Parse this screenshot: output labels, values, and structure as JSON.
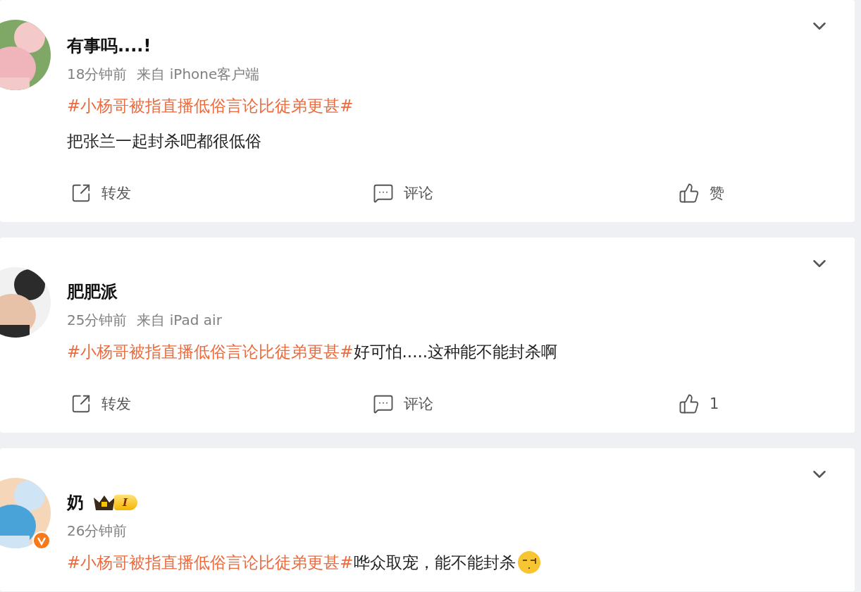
{
  "posts": [
    {
      "author": "有事吗....!",
      "verified": false,
      "time": "18分钟前",
      "source": "来自 iPhone客户端",
      "paragraphs": [
        [
          {
            "kind": "hashtag",
            "text": "#小杨哥被指直播低俗言论比徒弟更甚#"
          }
        ],
        [
          {
            "kind": "text",
            "text": "把张兰一起封杀吧都很低俗"
          }
        ]
      ],
      "actions": {
        "repost": "转发",
        "comment": "评论",
        "like": "赞"
      }
    },
    {
      "author": "肥肥派",
      "verified": false,
      "time": "25分钟前",
      "source": "来自 iPad air",
      "paragraphs": [
        [
          {
            "kind": "hashtag",
            "text": "#小杨哥被指直播低俗言论比徒弟更甚#"
          },
          {
            "kind": "text",
            "text": "好可怕.....这种能不能封杀啊"
          }
        ]
      ],
      "actions": {
        "repost": "转发",
        "comment": "评论",
        "like": "1"
      }
    },
    {
      "author": "奶",
      "verified": true,
      "level_badge": "I",
      "time": "26分钟前",
      "paragraphs": [
        [
          {
            "kind": "hashtag",
            "text": "#小杨哥被指直播低俗言论比徒弟更甚#"
          },
          {
            "kind": "text",
            "text": "哗众取宠，能不能封杀"
          },
          {
            "kind": "emoji"
          }
        ]
      ]
    }
  ]
}
